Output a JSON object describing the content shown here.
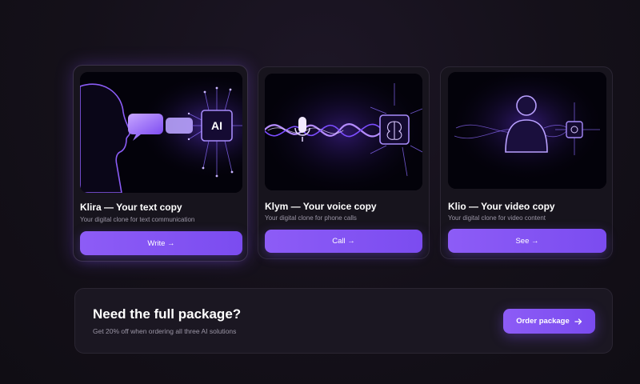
{
  "cards": [
    {
      "title": "Klira — Your text copy",
      "subtitle": "Your digital clone for text communication",
      "button_label": "Write →",
      "chip_label": "AI"
    },
    {
      "title": "Klym — Your voice copy",
      "subtitle": "Your digital clone for phone calls",
      "button_label": "Call →"
    },
    {
      "title": "Klio — Your video copy",
      "subtitle": "Your digital clone for video content",
      "button_label": "See →"
    }
  ],
  "banner": {
    "title": "Need the full package?",
    "subtitle": "Get 20% off when ordering all three AI solutions",
    "button_label": "Order package",
    "button_icon": "arrow-right-icon"
  },
  "colors": {
    "accent": "#8d5cf6",
    "background": "#141019",
    "card": "#17141d"
  }
}
